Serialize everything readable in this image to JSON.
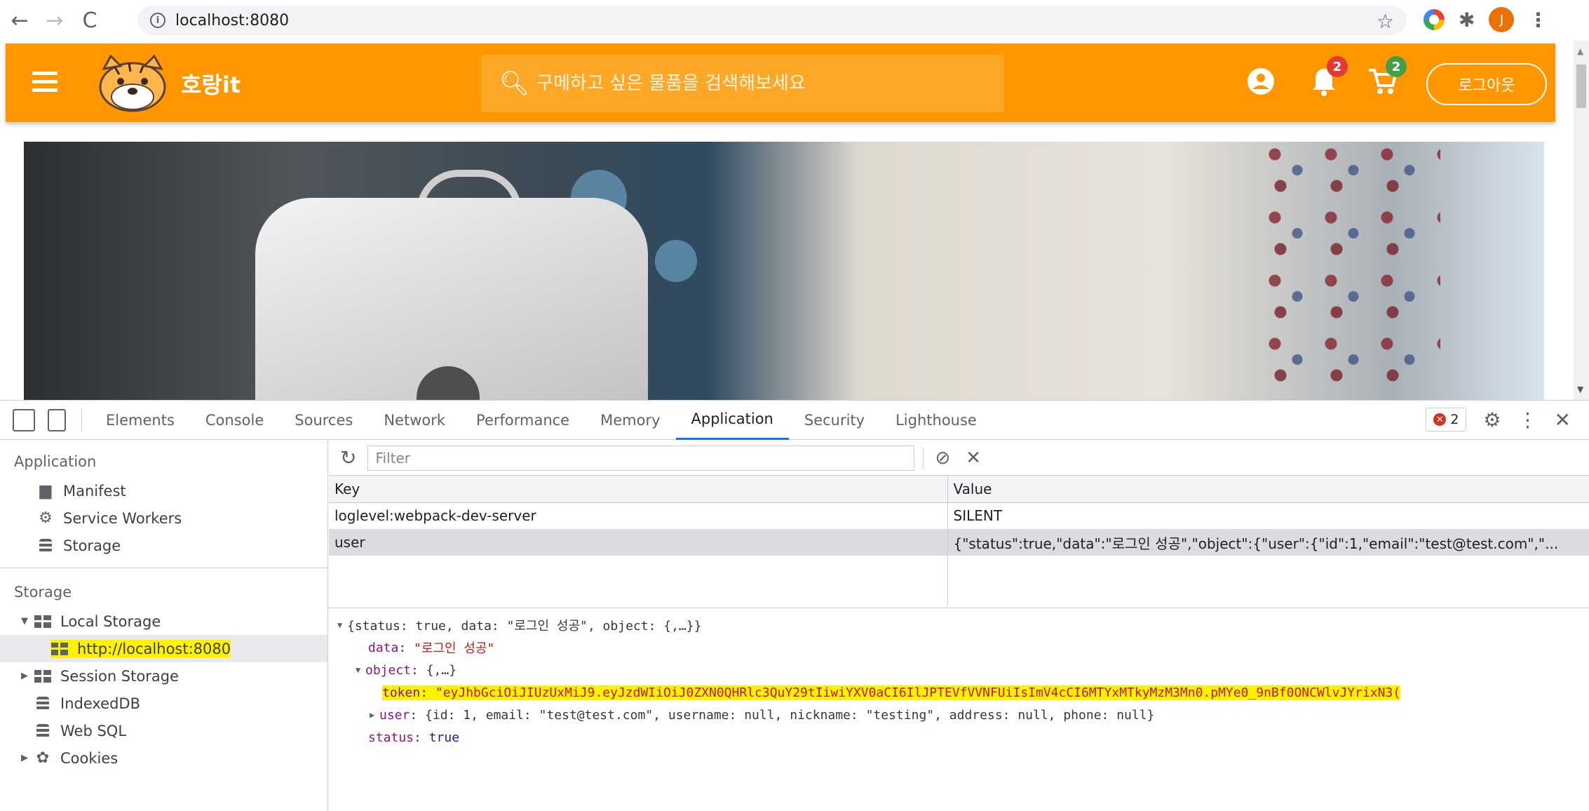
{
  "browser": {
    "url": "localhost:8080",
    "profile_initial": "J",
    "icons": [
      "back-arrow-icon",
      "forward-arrow-icon",
      "reload-icon",
      "info-icon",
      "star-icon",
      "extension-ring-icon",
      "puzzle-icon",
      "menu-dots-icon"
    ]
  },
  "site": {
    "brand": "호랑it",
    "search_placeholder": "구메하고 싶은 물품을 검색해보세요",
    "notification_count": "2",
    "cart_count": "2",
    "logout_label": "로그아웃",
    "colors": {
      "header": "#ff9800",
      "search": "#ffa726",
      "badge": "#e53935",
      "cart_badge": "#43a047"
    }
  },
  "devtools": {
    "tabs": [
      "Elements",
      "Console",
      "Sources",
      "Network",
      "Performance",
      "Memory",
      "Application",
      "Security",
      "Lighthouse"
    ],
    "active_tab": "Application",
    "error_count": "2",
    "sidebar": {
      "application_heading": "Application",
      "application_items": [
        "Manifest",
        "Service Workers",
        "Storage"
      ],
      "storage_heading": "Storage",
      "local_storage": "Local Storage",
      "local_origin": "http://localhost:8080",
      "session_storage": "Session Storage",
      "indexeddb": "IndexedDB",
      "websql": "Web SQL",
      "cookies": "Cookies"
    },
    "filter_placeholder": "Filter",
    "table": {
      "headers": [
        "Key",
        "Value"
      ],
      "rows": [
        {
          "key": "loglevel:webpack-dev-server",
          "value": "SILENT"
        },
        {
          "key": "user",
          "value": "{\"status\":true,\"data\":\"로그인 성공\",\"object\":{\"user\":{\"id\":1,\"email\":\"test@test.com\",\"..."
        }
      ]
    },
    "preview": {
      "summary": "{status: true, data: \"로그인 성공\", object: {,…}}",
      "data_key": "data",
      "data_value": "\"로그인 성공\"",
      "object_key": "object",
      "object_value": "{,…}",
      "token_key": "token",
      "token_value": "\"eyJhbGciOiJIUzUxMiJ9.eyJzdWIiOiJ0ZXN0QHRlc3QuY29tIiwiYXV0aCI6IlJPTEVfVVNFUiIsImV4cCI6MTYxMTkyMzM3Mn0.pMYe0_9nBf0ONCWlvJYrixN3(",
      "user_key": "user",
      "user_value": "{id: 1, email: \"test@test.com\", username: null, nickname: \"testing\", address: null, phone: null}",
      "status_key": "status",
      "status_value": "true"
    }
  }
}
